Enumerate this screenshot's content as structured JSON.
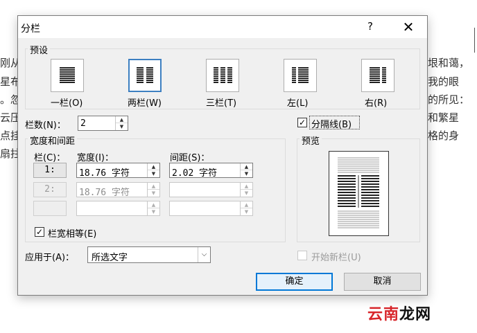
{
  "background": {
    "left_lines": [
      "刚从",
      "星布",
      "。忽",
      "云压",
      "点挂",
      "扇拄"
    ],
    "right_lines": [
      "垠和蔼，",
      "我的眼",
      "的所见：",
      "和繁星",
      "格的身"
    ]
  },
  "watermark": {
    "part1": "云南",
    "part2": "龙网"
  },
  "dialog": {
    "title": "分栏",
    "help_label": "?",
    "close_label": "✕",
    "presets": {
      "group_label": "预设",
      "items": [
        {
          "label": "一栏(O)",
          "icon": "one-column-icon"
        },
        {
          "label": "两栏(W)",
          "icon": "two-columns-icon",
          "selected": true
        },
        {
          "label": "三栏(T)",
          "icon": "three-columns-icon"
        },
        {
          "label": "左(L)",
          "icon": "left-narrow-column-icon"
        },
        {
          "label": "右(R)",
          "icon": "right-narrow-column-icon"
        }
      ]
    },
    "column_count": {
      "label": "栏数(N)：",
      "value": "2"
    },
    "separator": {
      "label": "分隔线(B)",
      "checked": true
    },
    "width_spacing": {
      "group_label": "宽度和间距",
      "col_header": "栏(C)：",
      "width_header": "宽度(I)：",
      "spacing_header": "间距(S)：",
      "rows": [
        {
          "col": "1:",
          "width": "18.76 字符",
          "spacing": "2.02 字符",
          "enabled": true
        },
        {
          "col": "2:",
          "width": "18.76 字符",
          "spacing": "",
          "enabled": false
        },
        {
          "col": "",
          "width": "",
          "spacing": "",
          "enabled": false
        }
      ]
    },
    "equal_width": {
      "label": "栏宽相等(E)",
      "checked": true
    },
    "preview": {
      "group_label": "预览"
    },
    "apply_to": {
      "label": "应用于(A)：",
      "value": "所选文字"
    },
    "new_column": {
      "label": "开始新栏(U)",
      "checked": false,
      "enabled": false
    },
    "ok_label": "确定",
    "cancel_label": "取消"
  },
  "colors": {
    "accent": "#0078d7",
    "selection_border": "#3c7fc1",
    "dialog_bg": "#f0f0f0"
  }
}
